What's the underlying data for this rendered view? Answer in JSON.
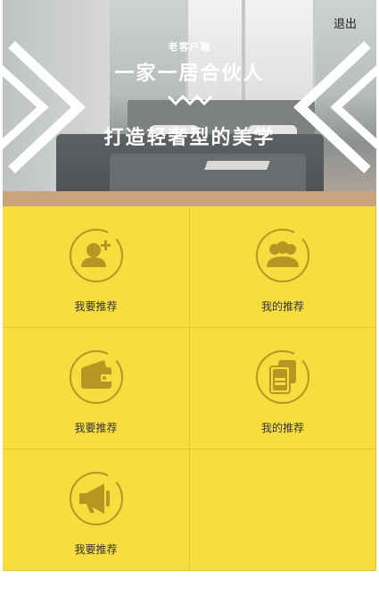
{
  "header": {
    "logout_label": "退出"
  },
  "banner": {
    "subtitle": "老客户端",
    "title_line1": "一家一居合伙人",
    "title_line2": "打造轻奢型的美学"
  },
  "menu": {
    "items": [
      {
        "label": "我要推荐",
        "icon": "add-user-icon"
      },
      {
        "label": "我的推荐",
        "icon": "group-icon"
      },
      {
        "label": "我要推荐",
        "icon": "wallet-icon"
      },
      {
        "label": "我的推荐",
        "icon": "cards-icon"
      },
      {
        "label": "我要推荐",
        "icon": "megaphone-icon"
      }
    ]
  },
  "colors": {
    "tile": "#f7dd3e",
    "icon": "#b99524",
    "divider": "#e8c52c"
  }
}
